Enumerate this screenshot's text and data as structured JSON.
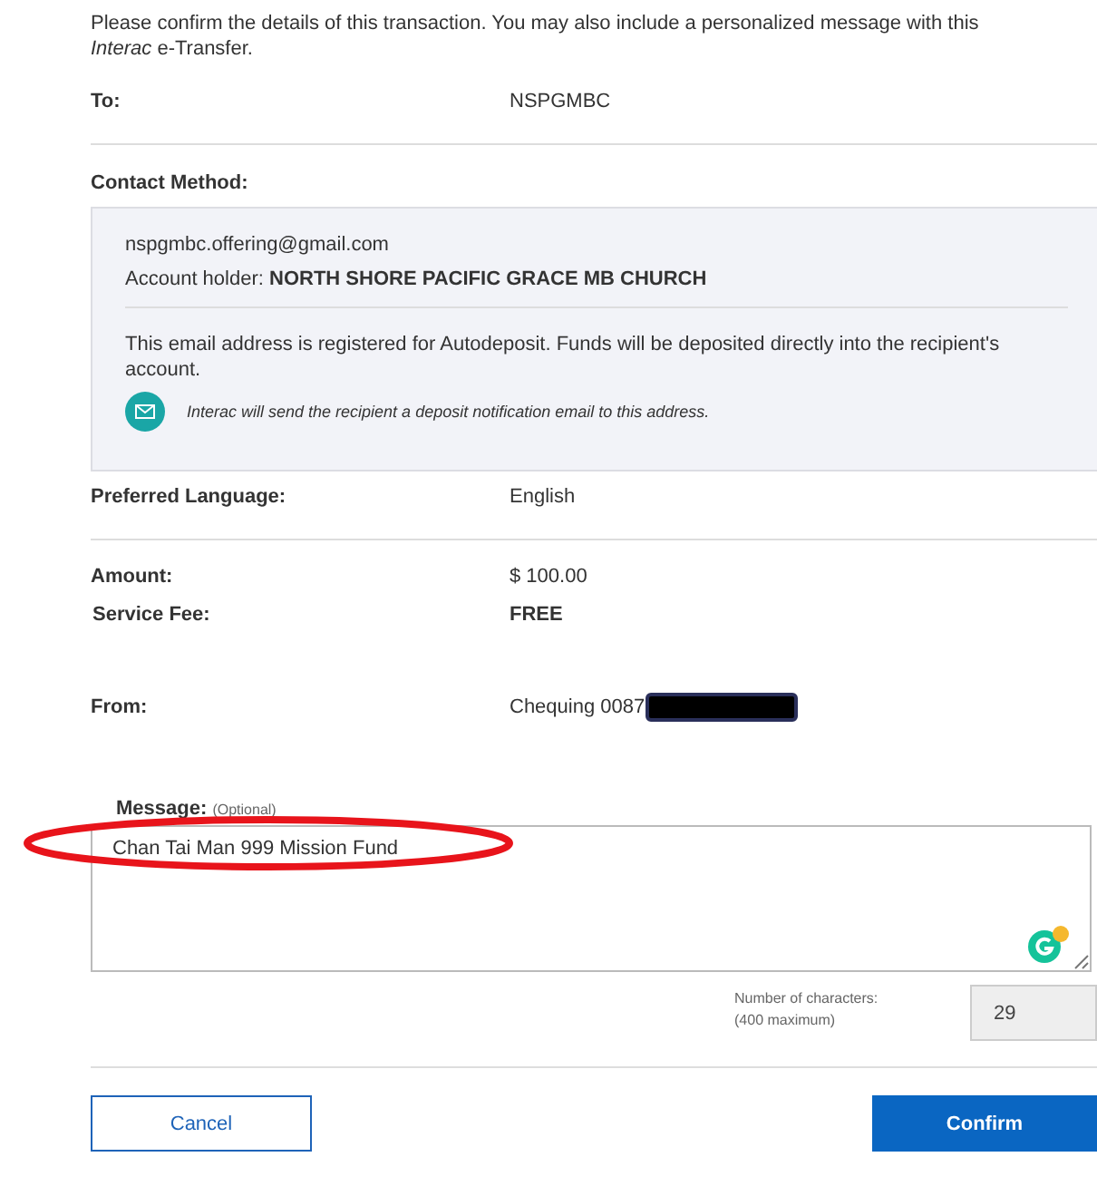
{
  "intro": "Please confirm the details of this transaction. You may also include a personalized message with this *Interac* e-Transfer.",
  "to": {
    "label": "To:",
    "value": "NSPGMBC"
  },
  "contact_method": {
    "label": "Contact Method:",
    "email": "nspgmbc.offering@gmail.com",
    "holder_label": "Account holder:",
    "holder": "NORTH SHORE PACIFIC GRACE MB CHURCH",
    "autodeposit_note": "This email address is registered for Autodeposit. Funds will be deposited directly into the recipient's account.",
    "notification": "Interac will send the recipient a deposit notification email to this address."
  },
  "language": {
    "label": "Preferred Language:",
    "value": "English"
  },
  "amount": {
    "label": "Amount:",
    "value": "$ 100.00"
  },
  "service_fee": {
    "label": "Service Fee:",
    "value": "FREE"
  },
  "from": {
    "label": "From:",
    "value": "Chequing 0087",
    "redacted": true
  },
  "message": {
    "label": "Message:",
    "hint": "(Optional)",
    "value": "Chan Tai Man 999 Mission Fund",
    "annotated": true
  },
  "char_count": {
    "label": "Number of characters:",
    "limit": "(400 maximum)",
    "value": "29"
  },
  "buttons": [
    {
      "kind": "secondary",
      "label": "Cancel"
    },
    {
      "kind": "primary",
      "label": "Confirm"
    }
  ]
}
